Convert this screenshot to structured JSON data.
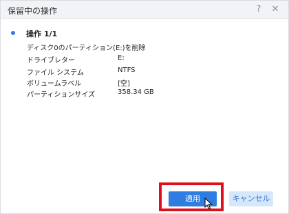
{
  "dialog": {
    "title": "保留中の操作",
    "help_icon": "?",
    "close_icon": "✕"
  },
  "operation": {
    "heading": "操作 1/1",
    "description": "ディスク0のパーティション(E:)を削除",
    "properties": [
      {
        "label": "ドライブレター",
        "value": "E:"
      },
      {
        "label": "ファイル システム",
        "value": "NTFS"
      },
      {
        "label": "ボリュームラベル",
        "value": "[空]"
      },
      {
        "label": "パーティションサイズ",
        "value": "358.34 GB"
      }
    ]
  },
  "buttons": {
    "apply": "適用",
    "cancel": "キャンセル"
  },
  "colors": {
    "accent": "#2f7de1",
    "highlight": "#e0101a",
    "cancel_bg": "#d7e7fb"
  },
  "icons": {
    "bullet": "bullet-dot-icon",
    "help": "help-icon",
    "close": "close-icon",
    "cursor": "mouse-pointer-icon"
  }
}
